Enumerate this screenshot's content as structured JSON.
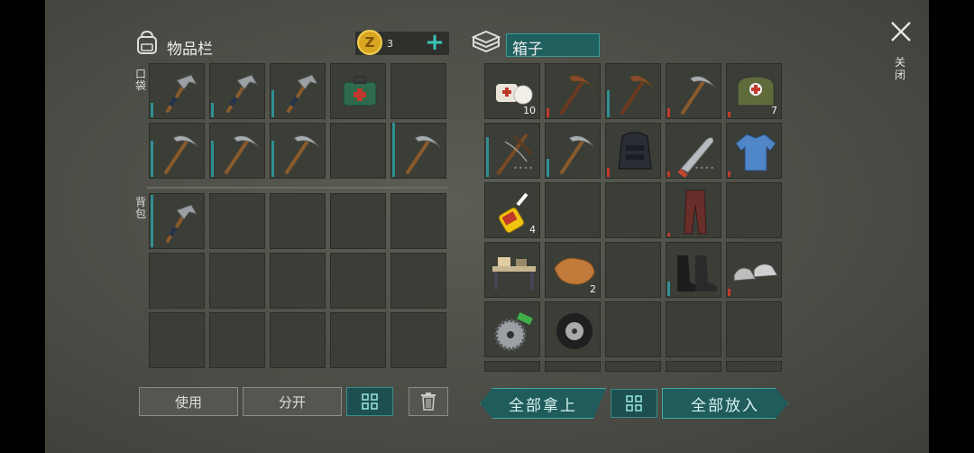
{
  "inventory": {
    "title": "物品栏",
    "coins": "3",
    "pocket_label": "口袋",
    "backpack_label": "背包",
    "buttons": {
      "use": "使用",
      "split": "分开"
    }
  },
  "box": {
    "title": "箱子",
    "buttons": {
      "take_all": "全部拿上",
      "put_all": "全部放入"
    }
  },
  "close_label": "关闭",
  "colors": {
    "accent": "#45a8a3",
    "durability_teal": "#2f8f93",
    "durability_red": "#c0392b"
  },
  "slots": {
    "bandage_count": "10",
    "medbag_count": "7",
    "glue_count": "4",
    "leather_count": "2"
  }
}
